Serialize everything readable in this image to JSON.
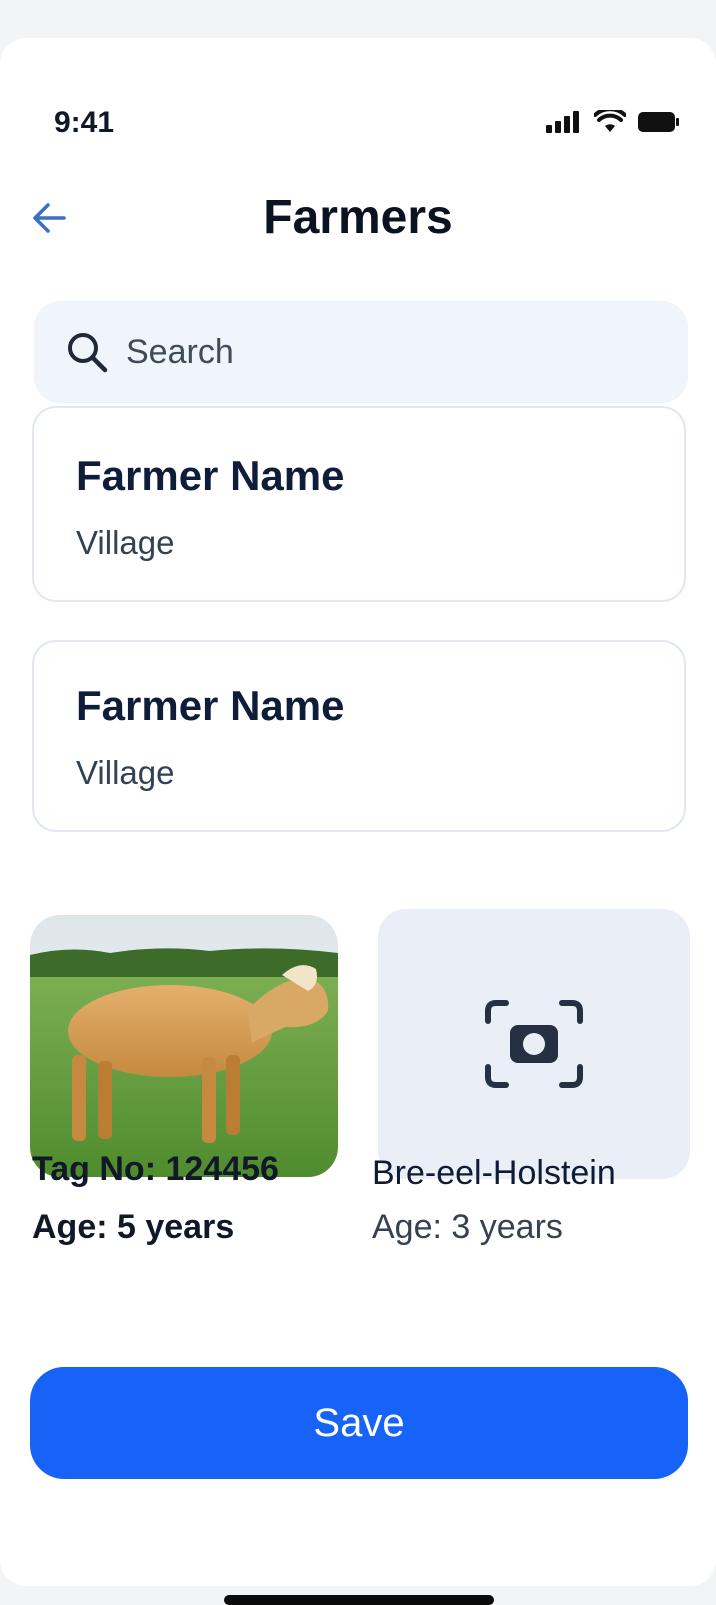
{
  "status_bar": {
    "time": "9:41"
  },
  "header": {
    "title": "Farmers"
  },
  "search": {
    "placeholder": "Search"
  },
  "farmers": [
    {
      "name": "Farmer Name",
      "village": "Village"
    },
    {
      "name": "Farmer Name",
      "village": "Village"
    }
  ],
  "animals": [
    {
      "tag": "Tag No: 124456",
      "age": "Age: 5 years"
    },
    {
      "breed": "Bre-eel-Holstein",
      "age": "Age: 3 years"
    }
  ],
  "actions": {
    "save_label": "Save"
  },
  "colors": {
    "accent": "#1763f7",
    "search_bg": "#f0f4fb",
    "placeholder_bg": "#e9eef7"
  }
}
